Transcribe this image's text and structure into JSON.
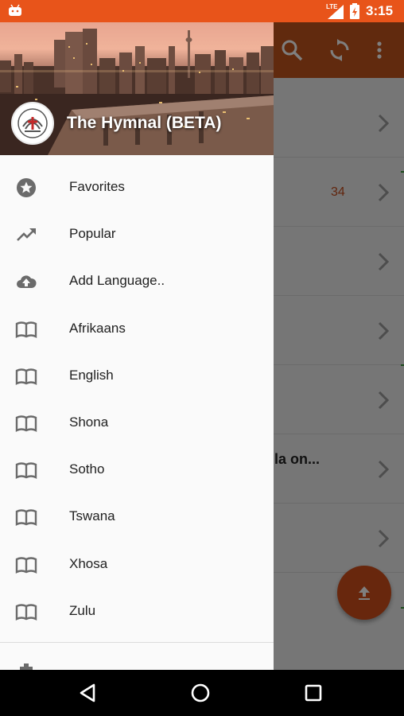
{
  "status_bar": {
    "network": "LTE",
    "time": "3:15",
    "icons": [
      "android-icon",
      "signal-icon",
      "battery-icon"
    ]
  },
  "app_bar": {
    "color": "#c2551c",
    "actions": [
      "search-icon",
      "sync-icon",
      "more-vert-icon"
    ]
  },
  "background_list": {
    "rows": [
      {
        "count": "",
        "title": ""
      },
      {
        "count": "34",
        "title": ""
      },
      {
        "count": "",
        "title": ""
      },
      {
        "count": "",
        "title": ""
      },
      {
        "count": "",
        "title": ""
      },
      {
        "count": "",
        "title": "lla on..."
      },
      {
        "count": "",
        "title": ""
      }
    ],
    "fab_icon": "upload-icon",
    "accent": "#d14e1a"
  },
  "drawer": {
    "title": "The Hymnal (BETA)",
    "items": [
      {
        "label": "Favorites",
        "icon": "star-icon"
      },
      {
        "label": "Popular",
        "icon": "trending-up-icon"
      },
      {
        "label": "Add Language..",
        "icon": "cloud-upload-icon"
      },
      {
        "label": "Afrikaans",
        "icon": "book-icon"
      },
      {
        "label": "English",
        "icon": "book-icon"
      },
      {
        "label": "Shona",
        "icon": "book-icon"
      },
      {
        "label": "Sotho",
        "icon": "book-icon"
      },
      {
        "label": "Tswana",
        "icon": "book-icon"
      },
      {
        "label": "Xhosa",
        "icon": "book-icon"
      },
      {
        "label": "Zulu",
        "icon": "book-icon"
      }
    ]
  },
  "nav_bar": {
    "buttons": [
      "back-icon",
      "home-icon",
      "recents-icon"
    ]
  }
}
